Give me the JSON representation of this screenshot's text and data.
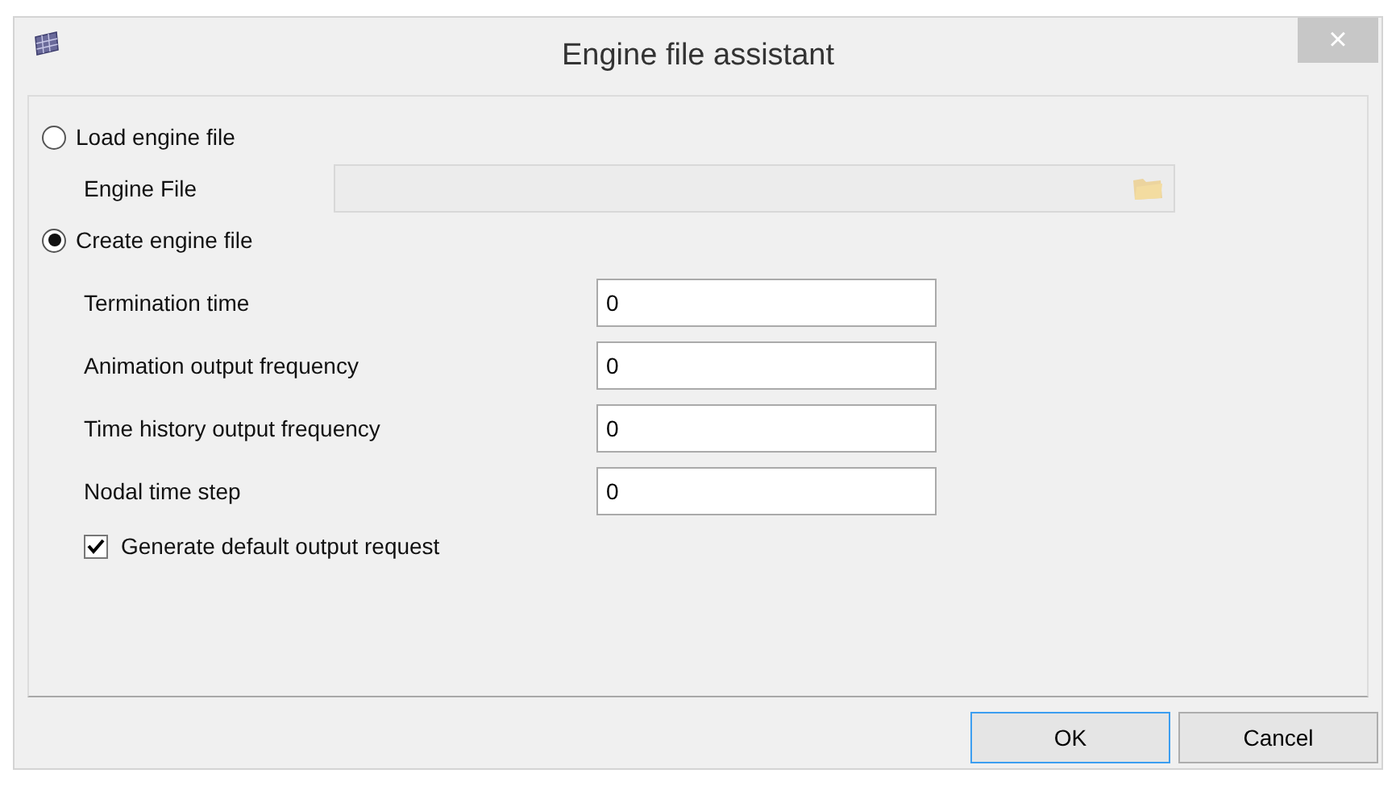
{
  "window": {
    "title": "Engine file assistant",
    "close": "×"
  },
  "options": [
    {
      "label": "Load engine file",
      "selected": false
    },
    {
      "label": "Create engine file",
      "selected": true
    }
  ],
  "engine_file": {
    "label": "Engine File",
    "disabled": true
  },
  "fields": [
    {
      "label": "Termination time",
      "value": "0"
    },
    {
      "label": "Animation output frequency",
      "value": "0"
    },
    {
      "label": "Time history output frequency",
      "value": "0"
    },
    {
      "label": "Nodal time step",
      "value": "0"
    }
  ],
  "checkbox": {
    "label": "Generate default output request",
    "checked": true
  },
  "buttons": [
    {
      "label": "OK",
      "focused": true
    },
    {
      "label": "Cancel",
      "focused": false
    }
  ]
}
